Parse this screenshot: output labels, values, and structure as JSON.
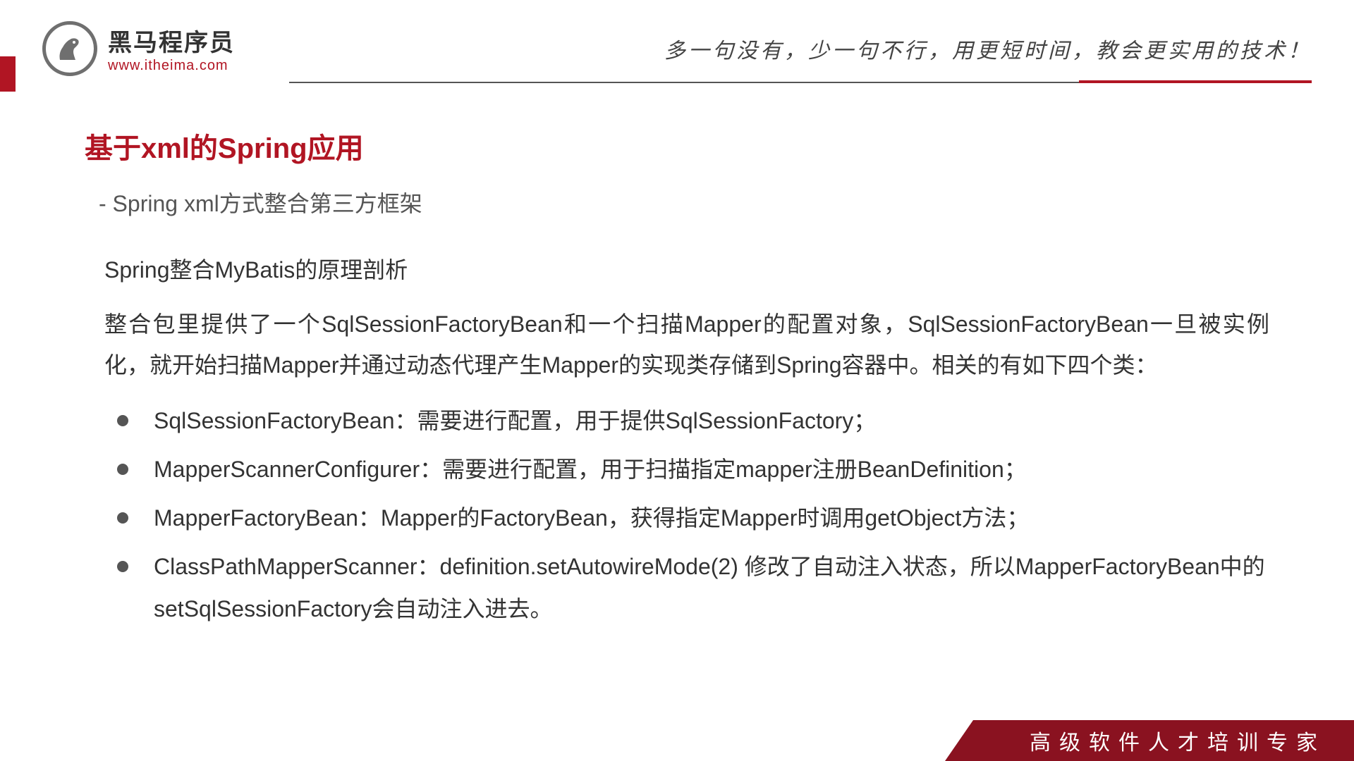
{
  "header": {
    "logo_cn": "黑马程序员",
    "logo_url": "www.itheima.com",
    "slogan": "多一句没有，少一句不行，用更短时间，教会更实用的技术！"
  },
  "content": {
    "title": "基于xml的Spring应用",
    "subtitle": "- Spring xml方式整合第三方框架",
    "section_title": "Spring整合MyBatis的原理剖析",
    "paragraph": "整合包里提供了一个SqlSessionFactoryBean和一个扫描Mapper的配置对象，SqlSessionFactoryBean一旦被实例化，就开始扫描Mapper并通过动态代理产生Mapper的实现类存储到Spring容器中。相关的有如下四个类：",
    "bullets": [
      "SqlSessionFactoryBean：需要进行配置，用于提供SqlSessionFactory；",
      "MapperScannerConfigurer：需要进行配置，用于扫描指定mapper注册BeanDefinition；",
      "MapperFactoryBean：Mapper的FactoryBean，获得指定Mapper时调用getObject方法；",
      "ClassPathMapperScanner：definition.setAutowireMode(2)  修改了自动注入状态，所以MapperFactoryBean中的setSqlSessionFactory会自动注入进去。"
    ]
  },
  "footer": {
    "banner": "高级软件人才培训专家"
  }
}
